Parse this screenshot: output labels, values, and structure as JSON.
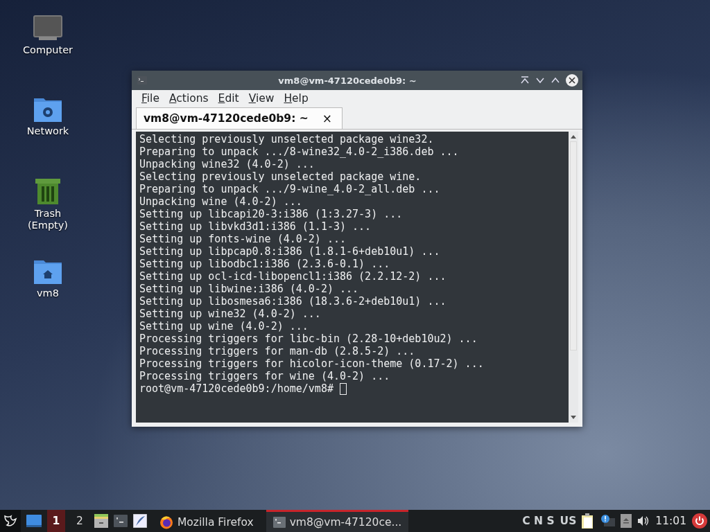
{
  "desktop_icons": [
    {
      "kind": "computer",
      "label": "Computer"
    },
    {
      "kind": "network",
      "label": "Network"
    },
    {
      "kind": "trash",
      "label": "Trash",
      "sublabel": "(Empty)"
    },
    {
      "kind": "home",
      "label": "vm8"
    }
  ],
  "window": {
    "title": "vm8@vm-47120cede0b9: ~",
    "menu": [
      "File",
      "Actions",
      "Edit",
      "View",
      "Help"
    ],
    "tabs": [
      {
        "label": "vm8@vm-47120cede0b9: ~",
        "close": "×",
        "selected": true
      }
    ],
    "terminal": {
      "lines": [
        "Selecting previously unselected package wine32.",
        "Preparing to unpack .../8-wine32_4.0-2_i386.deb ...",
        "Unpacking wine32 (4.0-2) ...",
        "Selecting previously unselected package wine.",
        "Preparing to unpack .../9-wine_4.0-2_all.deb ...",
        "Unpacking wine (4.0-2) ...",
        "Setting up libcapi20-3:i386 (1:3.27-3) ...",
        "Setting up libvkd3d1:i386 (1.1-3) ...",
        "Setting up fonts-wine (4.0-2) ...",
        "Setting up libpcap0.8:i386 (1.8.1-6+deb10u1) ...",
        "Setting up libodbc1:i386 (2.3.6-0.1) ...",
        "Setting up ocl-icd-libopencl1:i386 (2.2.12-2) ...",
        "Setting up libwine:i386 (4.0-2) ...",
        "Setting up libosmesa6:i386 (18.3.6-2+deb10u1) ...",
        "Setting up wine32 (4.0-2) ...",
        "Setting up wine (4.0-2) ...",
        "Processing triggers for libc-bin (2.28-10+deb10u2) ...",
        "Processing triggers for man-db (2.8.5-2) ...",
        "Processing triggers for hicolor-icon-theme (0.17-2) ...",
        "Processing triggers for wine (4.0-2) ..."
      ],
      "prompt": "root@vm-47120cede0b9:/home/vm8#"
    }
  },
  "taskbar": {
    "workspaces": [
      {
        "label": "1",
        "selected": true
      },
      {
        "label": "2",
        "selected": false
      }
    ],
    "launchers": [
      {
        "kind": "files"
      },
      {
        "kind": "terminal"
      },
      {
        "kind": "editor"
      }
    ],
    "tasks": [
      {
        "kind": "firefox",
        "label": "Mozilla Firefox",
        "selected": false
      },
      {
        "kind": "terminal",
        "label": "vm8@vm-47120ce...",
        "selected": true
      }
    ],
    "lock_keys": "C N S",
    "layout": "US",
    "clock": "11:01"
  }
}
